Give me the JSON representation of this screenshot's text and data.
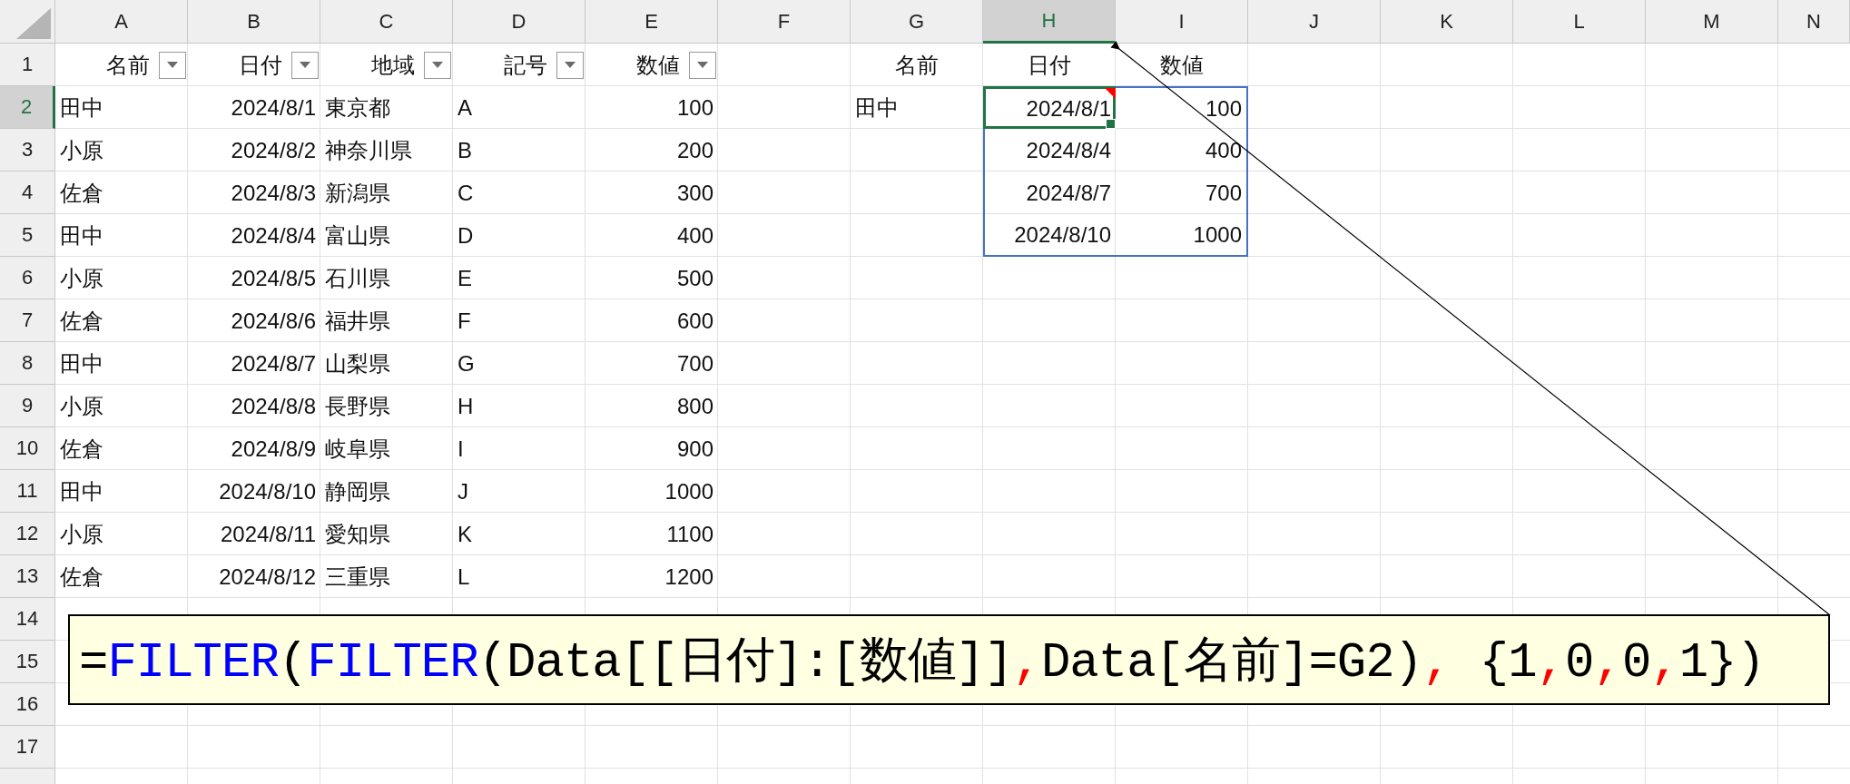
{
  "column_headers": [
    {
      "label": "A",
      "selected": false
    },
    {
      "label": "B",
      "selected": false
    },
    {
      "label": "C",
      "selected": false
    },
    {
      "label": "D",
      "selected": false
    },
    {
      "label": "E",
      "selected": false
    },
    {
      "label": "F",
      "selected": false
    },
    {
      "label": "G",
      "selected": false
    },
    {
      "label": "H",
      "selected": true
    },
    {
      "label": "I",
      "selected": false
    },
    {
      "label": "J",
      "selected": false
    },
    {
      "label": "K",
      "selected": false
    },
    {
      "label": "L",
      "selected": false
    },
    {
      "label": "M",
      "selected": false
    },
    {
      "label": "N",
      "selected": false
    }
  ],
  "row_headers": [
    {
      "label": "1",
      "selected": false
    },
    {
      "label": "2",
      "selected": true
    },
    {
      "label": "3",
      "selected": false
    },
    {
      "label": "4",
      "selected": false
    },
    {
      "label": "5",
      "selected": false
    },
    {
      "label": "6",
      "selected": false
    },
    {
      "label": "7",
      "selected": false
    },
    {
      "label": "8",
      "selected": false
    },
    {
      "label": "9",
      "selected": false
    },
    {
      "label": "10",
      "selected": false
    },
    {
      "label": "11",
      "selected": false
    },
    {
      "label": "12",
      "selected": false
    },
    {
      "label": "13",
      "selected": false
    },
    {
      "label": "14",
      "selected": false
    },
    {
      "label": "15",
      "selected": false
    },
    {
      "label": "16",
      "selected": false
    },
    {
      "label": "17",
      "selected": false
    }
  ],
  "table": {
    "columns": [
      {
        "name": "名前",
        "kind": "text"
      },
      {
        "name": "日付",
        "kind": "date"
      },
      {
        "name": "地域",
        "kind": "text"
      },
      {
        "name": "記号",
        "kind": "text"
      },
      {
        "name": "数値",
        "kind": "number"
      }
    ],
    "rows": [
      [
        "田中",
        "2024/8/1",
        "東京都",
        "A",
        "100"
      ],
      [
        "小原",
        "2024/8/2",
        "神奈川県",
        "B",
        "200"
      ],
      [
        "佐倉",
        "2024/8/3",
        "新潟県",
        "C",
        "300"
      ],
      [
        "田中",
        "2024/8/4",
        "富山県",
        "D",
        "400"
      ],
      [
        "小原",
        "2024/8/5",
        "石川県",
        "E",
        "500"
      ],
      [
        "佐倉",
        "2024/8/6",
        "福井県",
        "F",
        "600"
      ],
      [
        "田中",
        "2024/8/7",
        "山梨県",
        "G",
        "700"
      ],
      [
        "小原",
        "2024/8/8",
        "長野県",
        "H",
        "800"
      ],
      [
        "佐倉",
        "2024/8/9",
        "岐阜県",
        "I",
        "900"
      ],
      [
        "田中",
        "2024/8/10",
        "静岡県",
        "J",
        "1000"
      ],
      [
        "小原",
        "2024/8/11",
        "愛知県",
        "K",
        "1100"
      ],
      [
        "佐倉",
        "2024/8/12",
        "三重県",
        "L",
        "1200"
      ]
    ]
  },
  "lookup": {
    "headers": [
      "名前",
      "日付",
      "数値"
    ],
    "name": "田中",
    "results": [
      {
        "date": "2024/8/1",
        "value": "100",
        "selected": true,
        "has_comment": true
      },
      {
        "date": "2024/8/4",
        "value": "400",
        "selected": false,
        "has_comment": false
      },
      {
        "date": "2024/8/7",
        "value": "700",
        "selected": false,
        "has_comment": false
      },
      {
        "date": "2024/8/10",
        "value": "1000",
        "selected": false,
        "has_comment": false
      }
    ]
  },
  "comment": {
    "segments": [
      {
        "text": "=",
        "color": "#000000"
      },
      {
        "text": "FILTER",
        "color": "#0000ff"
      },
      {
        "text": "(",
        "color": "#000000"
      },
      {
        "text": "FILTER",
        "color": "#0000ff"
      },
      {
        "text": "(Data[[日付]:[数値]]",
        "color": "#000000"
      },
      {
        "text": ",",
        "color": "#ff0000"
      },
      {
        "text": "Data[名前]=G2)",
        "color": "#000000"
      },
      {
        "text": ",",
        "color": "#ff0000"
      },
      {
        "text": " {1",
        "color": "#000000"
      },
      {
        "text": ",",
        "color": "#ff0000"
      },
      {
        "text": "0",
        "color": "#000000"
      },
      {
        "text": ",",
        "color": "#ff0000"
      },
      {
        "text": "0",
        "color": "#000000"
      },
      {
        "text": ",",
        "color": "#ff0000"
      },
      {
        "text": "1})",
        "color": "#000000"
      }
    ]
  }
}
